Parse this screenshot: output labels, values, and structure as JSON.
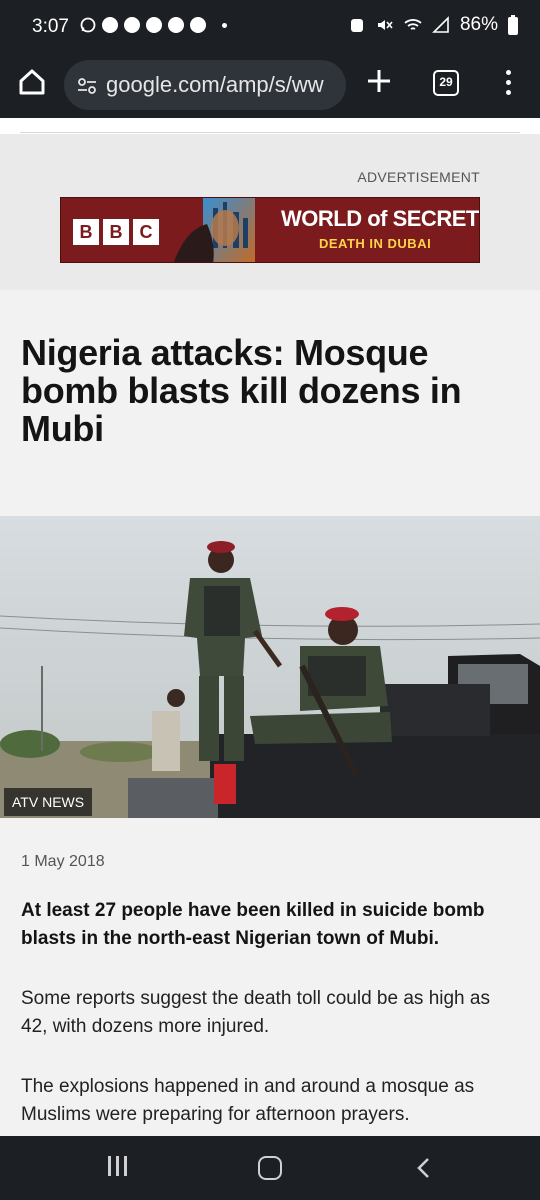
{
  "status_bar": {
    "time": "3:07",
    "battery": "86%",
    "icons": [
      "whatsapp-icon",
      "facebook-icon",
      "facebook-icon",
      "facebook-icon",
      "facebook-icon",
      "facebook-icon",
      "dot-icon",
      "alarm-icon",
      "mute-icon",
      "wifi-icon",
      "signal-icon",
      "battery-icon"
    ]
  },
  "browser": {
    "url": "google.com/amp/s/ww",
    "tab_count": "29",
    "icons": [
      "home-icon",
      "site-info-icon",
      "new-tab-icon",
      "tab-switcher-icon",
      "more-menu-icon"
    ]
  },
  "ad": {
    "label": "ADVERTISEMENT",
    "brand_letters": [
      "B",
      "B",
      "C"
    ],
    "title": "WORLD of SECRETS",
    "subtitle": "DEATH IN DUBAI"
  },
  "article": {
    "headline": "Nigeria attacks: Mosque bomb blasts kill dozens in Mubi",
    "image_credit": "ATV NEWS",
    "date": "1 May 2018",
    "lead": "At least 27 people have been killed in suicide bomb blasts in the north-east Nigerian town of Mubi.",
    "paragraphs": [
      "Some reports suggest the death toll could be as high as 42, with dozens more injured.",
      "The explosions happened in and around a mosque as Muslims were preparing for afternoon prayers."
    ]
  },
  "nav_bar": {
    "icons": [
      "recent-apps-icon",
      "home-button-icon",
      "back-icon"
    ]
  },
  "colors": {
    "system_bar": "#1c1f24",
    "page_bg": "#f2f2f2",
    "ad_bg": "#eaeaea",
    "ad_banner": "#7b1b1d",
    "ad_accent": "#ffd447"
  }
}
